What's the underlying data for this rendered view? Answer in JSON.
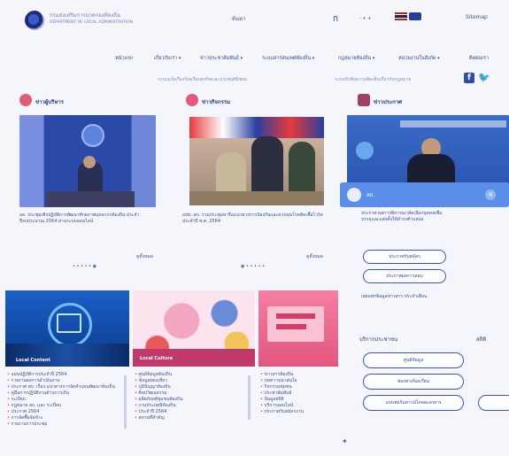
{
  "header": {
    "org_line1": "กรมส่งเสริมการปกครองท้องถิ่น",
    "org_line2": "DEPARTMENT OF LOCAL ADMINISTRATION",
    "center_link": "ค้นหา",
    "lang_th": "ไทย",
    "lang_en": "EN",
    "right_link": "Sitemap"
  },
  "nav": {
    "items": [
      "หน้าแรก",
      "เกี่ยวกับเรา",
      "ข่าวประชาสัมพันธ์",
      "ระบบสารสนเทศท้องถิ่น",
      "กฎหมายท้องถิ่น",
      "หน่วยงานในสังกัด",
      "ติดต่อเรา"
    ],
    "sub_links": [
      "ระบบแจ้งเรื่องร้องเรียนทุจริตและประพฤติมิชอบ",
      "ระบบรับฟังความคิดเห็นเกี่ยวกับกฎหมาย"
    ]
  },
  "sections": {
    "s1": "ข่าวผู้บริหาร",
    "s2": "ข่าวกิจกรรม",
    "s3": "ข่าวประกาศ"
  },
  "captions": {
    "c1": "อธ. ประชุมเชิงปฏิบัติการพัฒนาศักยภาพบุคลากรท้องถิ่น ประจำปีงบประมาณ 2564 ผ่านระบบออนไลน์",
    "c2": "อปท. สถ. ร่วมประชุมหารือแนวทางการป้องกันและควบคุมโรคติดเชื้อไวรัส ประจำปี พ.ศ. 2564"
  },
  "more_label": "ดูทั้งหมด",
  "popup": {
    "title": "สถ.",
    "text": "ประกาศ ผลการพิจารณาคัดเลือกบุคคลเพื่อบรรจุและแต่งตั้งให้ดำรงตำแหน่ง",
    "btn1": "ประกาศรับสมัคร",
    "btn2": "ประกาศผลการสอบ",
    "note": "เผยแพร่ข้อมูลข่าวสาร ประจำเดือน"
  },
  "side": {
    "heading": "บริการประชาชน",
    "pills": [
      "ศูนย์ข้อมูล",
      "ช่องทางร้องเรียน",
      "แบบฟอร์มดาวน์โหลดเอกสาร"
    ],
    "right_heading": "สถิติ"
  },
  "cards": {
    "card1_banner": "Local Content",
    "card1_items": [
      "แผนปฏิบัติการประจำปี 2564",
      "รายงานผลการดำเนินงาน",
      "ประกาศ สถ. เรื่อง แนวทางการจัดทำแผนพัฒนาท้องถิ่น",
      "คู่มือการปฏิบัติงานด้านการเงิน",
      "ระเบียบ",
      "กฎหมาย สถ. และ ระเบียบ",
      "ประกาศ 2564",
      "การจัดซื้อจัดจ้าง",
      "รายงานการประชุม"
    ],
    "card2_banner": "Local Culture",
    "card2_items": [
      "ศูนย์ข้อมูลท้องถิ่น",
      "ข้อมูลท่องเที่ยว",
      "ภูมิปัญญาท้องถิ่น",
      "ศิลปวัฒนธรรม",
      "ผลิตภัณฑ์ชุมชนท้องถิ่น",
      "งานประเพณีท้องถิ่น",
      "ประจำปี 2564",
      "สถานที่สำคัญ"
    ],
    "card3_items": [
      "ข่าวสารท้องถิ่น",
      "บทความน่าสนใจ",
      "กิจกรรมชุมชน",
      "ประชาสัมพันธ์",
      "ข้อมูลสถิติ",
      "บริการออนไลน์",
      "ประกาศรับสมัครงาน"
    ]
  },
  "icons": {
    "facebook": "facebook-icon",
    "twitter": "twitter-icon"
  }
}
